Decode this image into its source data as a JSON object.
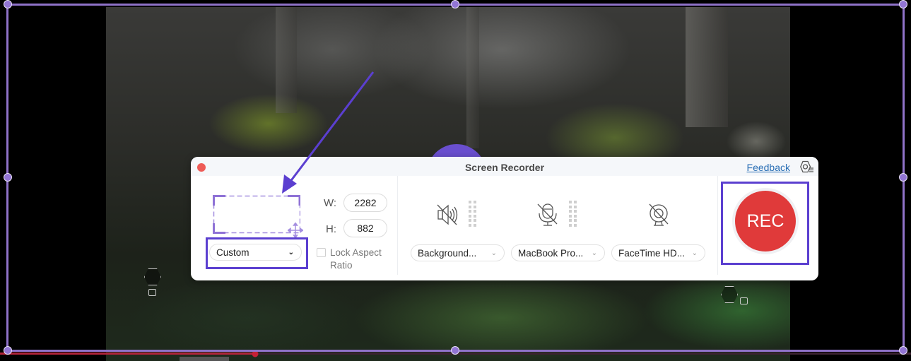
{
  "dialog": {
    "title": "Screen Recorder",
    "feedback_link": "Feedback",
    "area": {
      "width_label": "W:",
      "width_value": "2282",
      "height_label": "H:",
      "height_value": "882",
      "preset_selected": "Custom",
      "lock_aspect_label": "Lock Aspect Ratio",
      "lock_aspect_checked": false
    },
    "devices": [
      {
        "icon": "speaker-muted-icon",
        "selected": "Background...",
        "muted": true,
        "has_meter": true
      },
      {
        "icon": "microphone-muted-icon",
        "selected": "MacBook Pro...",
        "muted": true,
        "has_meter": true
      },
      {
        "icon": "webcam-off-icon",
        "selected": "FaceTime HD...",
        "muted": true,
        "has_meter": false
      }
    ],
    "record_button": "REC"
  },
  "annotations": {
    "highlight_color": "#5b3fd0",
    "arrow_color": "#5b3fd0"
  },
  "colors": {
    "frame": "#8f72c9",
    "rec_red": "#e03a3a",
    "link": "#2a6fb5",
    "progress": "#b0243a"
  },
  "playback": {
    "progress_fraction": 0.28
  }
}
